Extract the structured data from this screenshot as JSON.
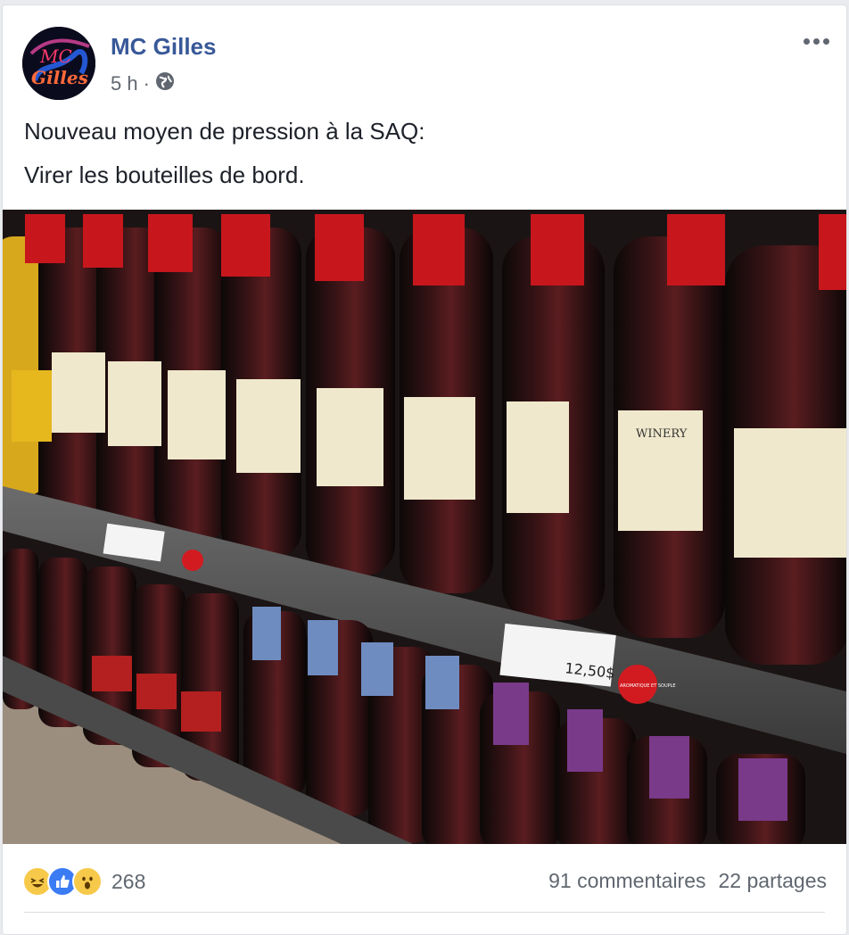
{
  "post": {
    "author": "MC Gilles",
    "avatar_text": "MC Gilles",
    "time": "5 h",
    "separator": "·",
    "visibility_icon": "globe-icon",
    "menu_icon": "more-options-icon",
    "text_lines": [
      "Nouveau moyen de pression à la SAQ:",
      "Virer les bouteilles de bord."
    ],
    "image_labels": {
      "price_tag": "12,50$",
      "sticker": "AROMATIQUE ET SOUPLE",
      "winery_label": "WINERY"
    }
  },
  "footer": {
    "reactions": [
      "haha-icon",
      "like-icon",
      "wow-icon"
    ],
    "reaction_count": "268",
    "comments": "91 commentaires",
    "shares": "22 partages"
  },
  "colors": {
    "link_blue": "#385898",
    "meta_gray": "#616770",
    "wine_red_cap": "#c8161d",
    "purple_cap": "#7a3a8a",
    "blue_cap": "#6e8cc0"
  }
}
